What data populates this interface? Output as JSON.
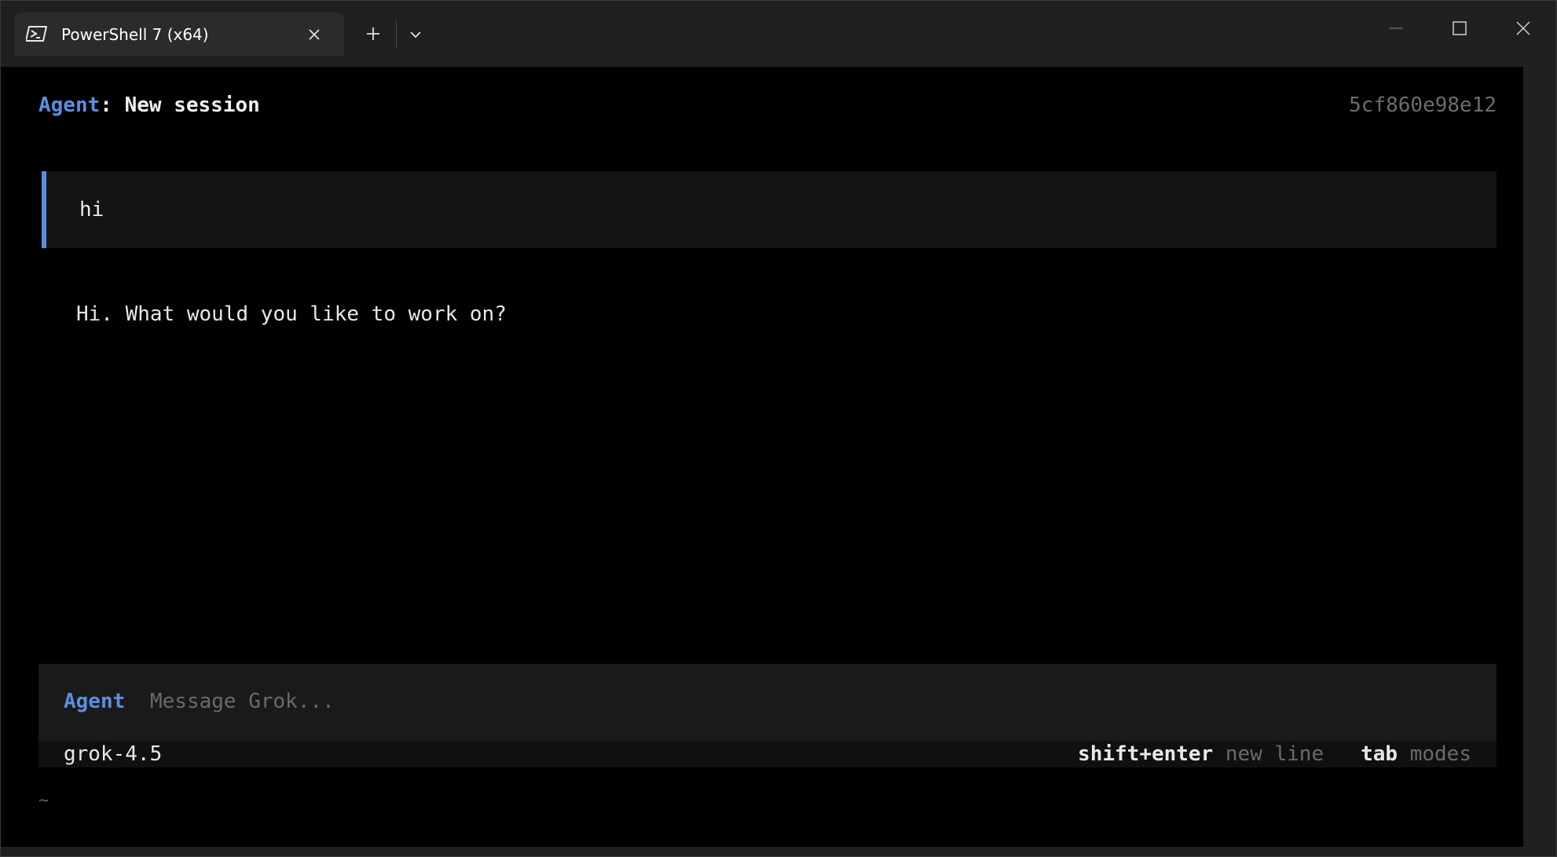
{
  "titlebar": {
    "tab_title": "PowerShell 7 (x64)",
    "tab_icon": "powershell-icon",
    "new_tab_icon": "plus-icon",
    "dropdown_icon": "chevron-down-icon",
    "close_tab_icon": "close-icon",
    "window_controls": [
      "minimize-icon",
      "maximize-icon",
      "close-icon"
    ]
  },
  "header": {
    "agent_label": "Agent",
    "separator": ":",
    "session_title": "New session",
    "session_id": "5cf860e98e12"
  },
  "conversation": {
    "user_message": "hi",
    "assistant_message": "Hi. What would you like to work on?"
  },
  "input": {
    "mode_label": "Agent",
    "placeholder": "Message Grok...",
    "value": ""
  },
  "status_bar": {
    "model": "grok-4.5",
    "hints": [
      {
        "key": "shift+enter",
        "desc": "new line"
      },
      {
        "key": "tab",
        "desc": "modes"
      }
    ]
  },
  "shell_prompt": "~",
  "colors": {
    "accent": "#5a8fe0",
    "terminal_bg": "#000000",
    "titlebar_bg": "#202020",
    "tab_bg": "#2b2b2b"
  }
}
